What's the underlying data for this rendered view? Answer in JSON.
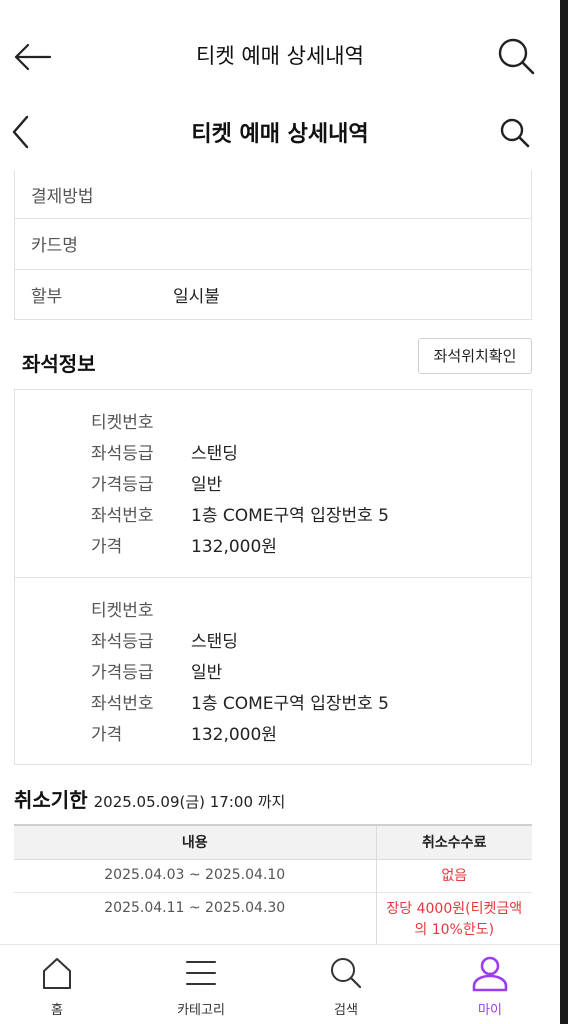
{
  "header_top": {
    "title": "티켓 예매 상세내역"
  },
  "header": {
    "title": "티켓 예매 상세내역"
  },
  "payment": {
    "rows": [
      {
        "label": "결제방법",
        "value": ""
      },
      {
        "label": "카드명",
        "value": ""
      },
      {
        "label": "할부",
        "value": "일시불"
      }
    ]
  },
  "seat_info": {
    "title": "좌석정보",
    "location_button": "좌석위치확인",
    "tickets": [
      {
        "rows": [
          {
            "label": "티켓번호",
            "value": ""
          },
          {
            "label": "좌석등급",
            "value": "스탠딩"
          },
          {
            "label": "가격등급",
            "value": "일반"
          },
          {
            "label": "좌석번호",
            "value": "1층 COME구역 입장번호 5"
          },
          {
            "label": "가격",
            "value": "132,000원"
          }
        ]
      },
      {
        "rows": [
          {
            "label": "티켓번호",
            "value": ""
          },
          {
            "label": "좌석등급",
            "value": "스탠딩"
          },
          {
            "label": "가격등급",
            "value": "일반"
          },
          {
            "label": "좌석번호",
            "value": "1층 COME구역 입장번호 5"
          },
          {
            "label": "가격",
            "value": "132,000원"
          }
        ]
      }
    ]
  },
  "cancel": {
    "label": "취소기한",
    "deadline": "2025.05.09(금) 17:00 까지",
    "table": {
      "headers": [
        "내용",
        "취소수수료"
      ],
      "rows": [
        {
          "period": "2025.04.03 ~ 2025.04.10",
          "fee": "없음"
        },
        {
          "period": "2025.04.11 ~ 2025.04.30",
          "fee": "장당 4000원(티켓금액의 10%한도)"
        }
      ]
    }
  },
  "tabbar": {
    "items": [
      {
        "label": "홈",
        "icon": "home-icon"
      },
      {
        "label": "카테고리",
        "icon": "menu-icon"
      },
      {
        "label": "검색",
        "icon": "search-icon"
      },
      {
        "label": "마이",
        "icon": "user-icon"
      }
    ],
    "active_index": 3
  },
  "colors": {
    "accent": "#9b3df0",
    "fee_red": "#e8363b"
  }
}
